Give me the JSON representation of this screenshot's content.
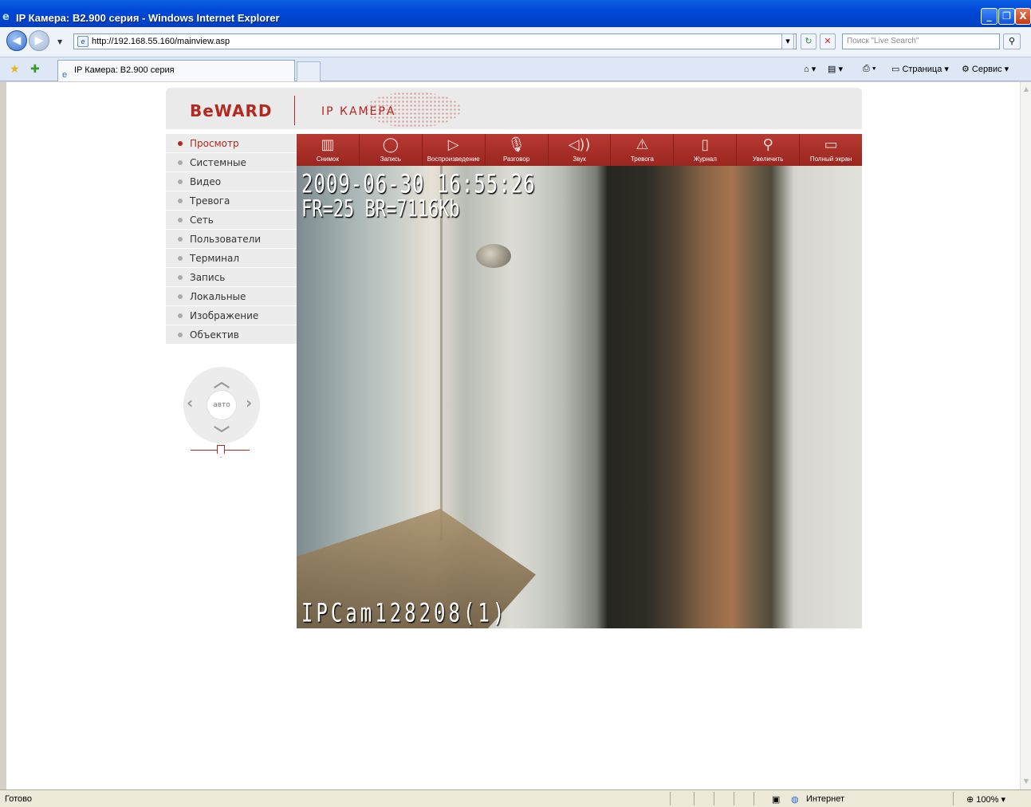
{
  "window": {
    "title": "IP Камера: B2.900 серия - Windows Internet Explorer",
    "min_glyph": "_",
    "max_glyph": "❐",
    "close_glyph": "X"
  },
  "addressbar": {
    "url": "http://192.168.55.160/mainview.asp",
    "search_placeholder": "Поиск \"Live Search\""
  },
  "tabs": [
    {
      "label": "IP Камера: B2.900 серия"
    }
  ],
  "commandbar": {
    "page_label": "Страница",
    "tools_label": "Сервис"
  },
  "page": {
    "logo": "BeWARD",
    "header_label": "IP КАМЕРА",
    "accent_color": "#b5281f",
    "menu": [
      {
        "label": "Просмотр",
        "active": true
      },
      {
        "label": "Системные"
      },
      {
        "label": "Видео"
      },
      {
        "label": "Тревога"
      },
      {
        "label": "Сеть"
      },
      {
        "label": "Пользователи"
      },
      {
        "label": "Терминал"
      },
      {
        "label": "Запись"
      },
      {
        "label": "Локальные"
      },
      {
        "label": "Изображение"
      },
      {
        "label": "Объектив"
      }
    ],
    "ptz": {
      "auto_label": "авто"
    },
    "toolbar": [
      {
        "label": "Снимок",
        "icon": "film-icon"
      },
      {
        "label": "Запись",
        "icon": "record-icon"
      },
      {
        "label": "Воспроизведение",
        "icon": "play-icon"
      },
      {
        "label": "Разговор",
        "icon": "microphone-icon"
      },
      {
        "label": "Звук",
        "icon": "speaker-icon"
      },
      {
        "label": "Тревога",
        "icon": "alarm-icon"
      },
      {
        "label": "Журнал",
        "icon": "log-icon"
      },
      {
        "label": "Увеличить",
        "icon": "zoom-icon"
      },
      {
        "label": "Полный экран",
        "icon": "fullscreen-icon"
      }
    ],
    "video": {
      "timestamp": "2009-06-30 16:55:26",
      "rate": "FR=25 BR=7116Kb",
      "camera_name": "IPCam128208(1)"
    }
  },
  "statusbar": {
    "status": "Готово",
    "zone": "Интернет",
    "zoom": "100%"
  }
}
